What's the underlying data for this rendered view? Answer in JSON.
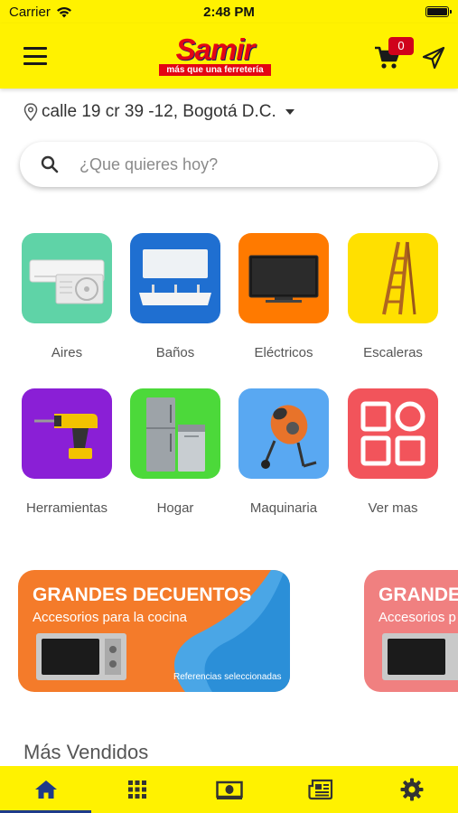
{
  "status_bar": {
    "carrier": "Carrier",
    "time": "2:48 PM"
  },
  "header": {
    "logo_text": "Samir",
    "logo_tagline": "más que una ferretería",
    "cart_count": "0",
    "brand_color": "#fff200"
  },
  "location": {
    "address": "calle 19 cr 39 -12, Bogotá D.C."
  },
  "search": {
    "placeholder": "¿Que quieres hoy?"
  },
  "categories": [
    {
      "label": "Aires",
      "color": "#5fd3a7",
      "icon": "air-conditioner-icon"
    },
    {
      "label": "Baños",
      "color": "#1f6fd1",
      "icon": "bathroom-sink-icon"
    },
    {
      "label": "Eléctricos",
      "color": "#ff7a00",
      "icon": "television-icon"
    },
    {
      "label": "Escaleras",
      "color": "#ffe000",
      "icon": "ladder-icon"
    },
    {
      "label": "Herramientas",
      "color": "#8a1fd6",
      "icon": "drill-icon"
    },
    {
      "label": "Hogar",
      "color": "#4cd93a",
      "icon": "fridge-dishwasher-icon"
    },
    {
      "label": "Maquinaria",
      "color": "#59a8f2",
      "icon": "concrete-mixer-icon"
    },
    {
      "label": "Ver mas",
      "color": "#f2545b",
      "icon": "grid-shapes-icon"
    }
  ],
  "banners": [
    {
      "title": "GRANDES DECUENTOS",
      "subtitle": "Accesorios para la cocina",
      "note": "Referencias seleccionadas",
      "color": "#f47b2a"
    },
    {
      "title": "GRANDES",
      "subtitle": "Accesorios p",
      "color": "#f08080"
    }
  ],
  "sections": {
    "best_sellers": "Más Vendidos"
  },
  "tabbar": {
    "items": [
      {
        "icon": "home-icon",
        "active": true
      },
      {
        "icon": "grid-icon",
        "active": false
      },
      {
        "icon": "cash-icon",
        "active": false
      },
      {
        "icon": "newspaper-icon",
        "active": false
      },
      {
        "icon": "settings-gear-icon",
        "active": false
      }
    ],
    "active_color": "#1e3a8a"
  }
}
